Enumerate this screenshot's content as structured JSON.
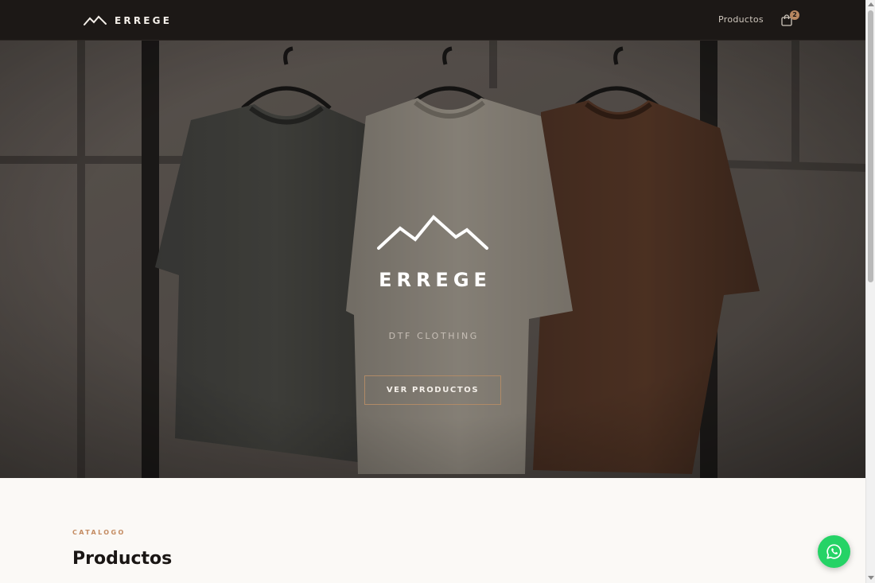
{
  "header": {
    "brand_name": "ERREGE",
    "nav_link": "Productos",
    "cart_count": "2"
  },
  "hero": {
    "title": "ERREGE",
    "tagline": "DTF CLOTHING",
    "cta_label": "VER PRODUCTOS"
  },
  "catalog": {
    "eyebrow": "CATALOGO",
    "title": "Productos"
  },
  "icons": {
    "brand_mark": "mountain-logo-icon",
    "cart": "shopping-bag-icon",
    "whatsapp": "whatsapp-icon"
  },
  "colors": {
    "header_bg": "#1c1816",
    "accent": "#c48b61",
    "cta_border": "#b08a67",
    "page_bg": "#fbf9f6",
    "whatsapp": "#25d366"
  }
}
